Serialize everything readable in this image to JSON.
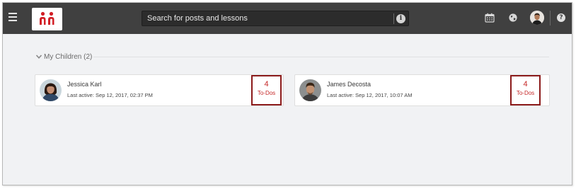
{
  "topbar": {
    "search_placeholder": "Search for posts and lessons",
    "icons": [
      "menu-icon",
      "app-logo",
      "info-icon",
      "calendar-icon",
      "globe-icon",
      "user-avatar",
      "help-icon"
    ]
  },
  "section": {
    "label": "My Children (2)",
    "expanded": true
  },
  "children": [
    {
      "name": "Jessica Karl",
      "last_active": "Last active: Sep 12, 2017, 02:37 PM",
      "todo_count": "4",
      "todo_label": "To-Dos"
    },
    {
      "name": "James Decosta",
      "last_active": "Last active: Sep 12, 2017, 10:07 AM",
      "todo_count": "4",
      "todo_label": "To-Dos"
    }
  ],
  "colors": {
    "topbar": "#404040",
    "background": "#f1f2f4",
    "brand_red": "#d21f26",
    "todo_text": "#c62828",
    "todo_border": "#8b1a1a"
  }
}
